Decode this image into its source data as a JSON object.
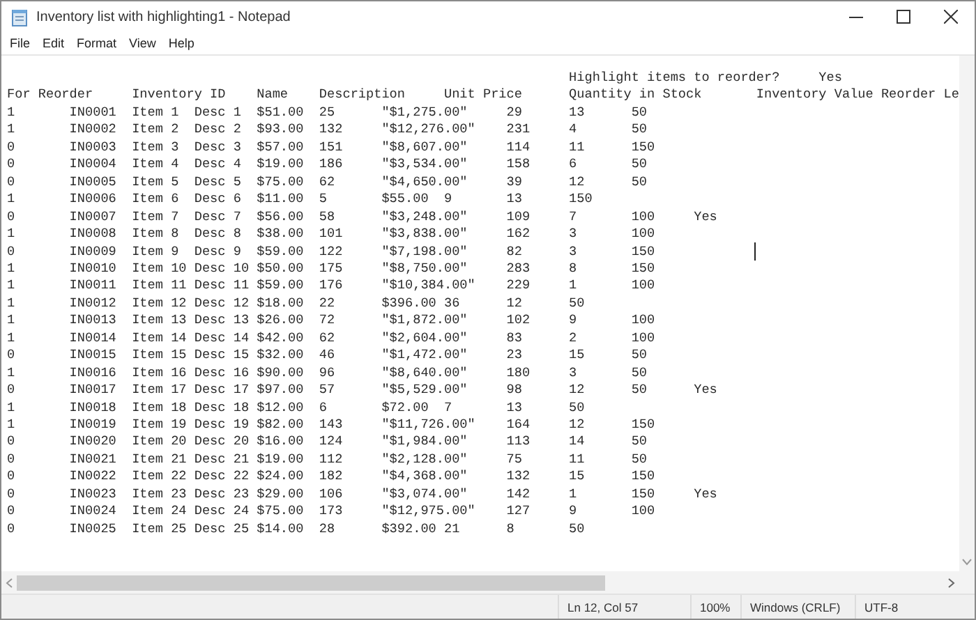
{
  "window": {
    "title": "Inventory list with highlighting1 - Notepad"
  },
  "menu": [
    "File",
    "Edit",
    "Format",
    "View",
    "Help"
  ],
  "lines": [
    "\t\t\t\t\t\t\t\t\tHighlight items to reorder?\tYes",
    "For Reorder\tInventory ID\tName\tDescription\tUnit Price\tQuantity in Stock\tInventory Value Reorder Le",
    "1\tIN0001\tItem 1\tDesc 1\t$51.00\t25\t\"$1,275.00\"\t29\t13\t50",
    "1\tIN0002\tItem 2\tDesc 2\t$93.00\t132\t\"$12,276.00\"\t231\t4\t50",
    "0\tIN0003\tItem 3\tDesc 3\t$57.00\t151\t\"$8,607.00\"\t114\t11\t150",
    "0\tIN0004\tItem 4\tDesc 4\t$19.00\t186\t\"$3,534.00\"\t158\t6\t50",
    "0\tIN0005\tItem 5\tDesc 5\t$75.00\t62\t\"$4,650.00\"\t39\t12\t50",
    "1\tIN0006\tItem 6\tDesc 6\t$11.00\t5\t$55.00\t9\t13\t150",
    "0\tIN0007\tItem 7\tDesc 7\t$56.00\t58\t\"$3,248.00\"\t109\t7\t100\tYes",
    "1\tIN0008\tItem 8\tDesc 8\t$38.00\t101\t\"$3,838.00\"\t162\t3\t100",
    "0\tIN0009\tItem 9\tDesc 9\t$59.00\t122\t\"$7,198.00\"\t82\t3\t150",
    "1\tIN0010\tItem 10\tDesc 10\t$50.00\t175\t\"$8,750.00\"\t283\t8\t150",
    "1\tIN0011\tItem 11\tDesc 11\t$59.00\t176\t\"$10,384.00\"\t229\t1\t100",
    "1\tIN0012\tItem 12\tDesc 12\t$18.00\t22\t$396.00\t36\t12\t50",
    "1\tIN0013\tItem 13\tDesc 13\t$26.00\t72\t\"$1,872.00\"\t102\t9\t100",
    "1\tIN0014\tItem 14\tDesc 14\t$42.00\t62\t\"$2,604.00\"\t83\t2\t100",
    "0\tIN0015\tItem 15\tDesc 15\t$32.00\t46\t\"$1,472.00\"\t23\t15\t50",
    "1\tIN0016\tItem 16\tDesc 16\t$90.00\t96\t\"$8,640.00\"\t180\t3\t50",
    "0\tIN0017\tItem 17\tDesc 17\t$97.00\t57\t\"$5,529.00\"\t98\t12\t50\tYes",
    "1\tIN0018\tItem 18\tDesc 18\t$12.00\t6\t$72.00\t7\t13\t50",
    "1\tIN0019\tItem 19\tDesc 19\t$82.00\t143\t\"$11,726.00\"\t164\t12\t150",
    "0\tIN0020\tItem 20\tDesc 20\t$16.00\t124\t\"$1,984.00\"\t113\t14\t50",
    "0\tIN0021\tItem 21\tDesc 21\t$19.00\t112\t\"$2,128.00\"\t75\t11\t50",
    "0\tIN0022\tItem 22\tDesc 22\t$24.00\t182\t\"$4,368.00\"\t132\t15\t150",
    "0\tIN0023\tItem 23\tDesc 23\t$29.00\t106\t\"$3,074.00\"\t142\t1\t150\tYes",
    "0\tIN0024\tItem 24\tDesc 24\t$75.00\t173\t\"$12,975.00\"\t127\t9\t100",
    "0\tIN0025\tItem 25\tDesc 25\t$14.00\t28\t$392.00\t21\t8\t50"
  ],
  "status_bar": {
    "position": "Ln 12, Col 57",
    "zoom": "100%",
    "line_ending": "Windows (CRLF)",
    "encoding": "UTF-8"
  }
}
